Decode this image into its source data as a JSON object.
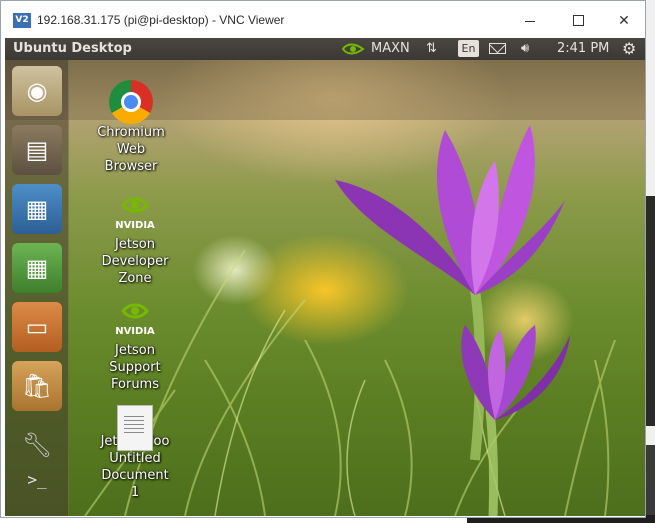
{
  "window": {
    "logo": "V2",
    "title": "192.168.31.175 (pi@pi-desktop) - VNC Viewer",
    "close_glyph": "✕"
  },
  "panel": {
    "title": "Ubuntu Desktop",
    "power_mode": "MAXN",
    "language": "En",
    "time": "2:41 PM",
    "updown_glyph": "⇅",
    "volume_glyph": "🔊︎",
    "gear_glyph": "⚙"
  },
  "launcher": {
    "items": [
      {
        "name": "ubuntu-dash",
        "glyph": "◉"
      },
      {
        "name": "files",
        "glyph": "▤"
      },
      {
        "name": "writer",
        "glyph": "▦"
      },
      {
        "name": "calc",
        "glyph": "▦"
      },
      {
        "name": "impress",
        "glyph": "▭"
      },
      {
        "name": "software",
        "glyph": "🛍︎"
      },
      {
        "name": "settings",
        "glyph": "🔧︎"
      },
      {
        "name": "terminal",
        "glyph": ">_"
      }
    ]
  },
  "desktop_icons": {
    "chromium": {
      "line1": "Chromium",
      "line2": "Web",
      "line3": "Browser"
    },
    "dev_zone": {
      "line1": "Jetson",
      "line2": "Developer",
      "line3": "Zone"
    },
    "forums": {
      "line1": "Jetson",
      "line2": "Support",
      "line3": "Forums"
    },
    "zoo": {
      "label": "Jetson Zoo"
    },
    "untitled": {
      "line1": "Untitled",
      "line2": "Document",
      "line3": "1"
    }
  },
  "colors": {
    "panel": "#3b3936",
    "nvidia_green": "#76b900",
    "flower": "#a23fc8"
  }
}
